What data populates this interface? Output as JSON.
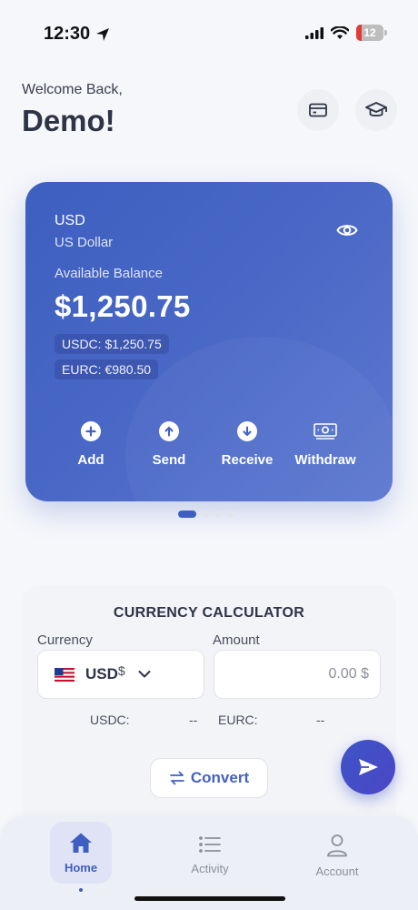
{
  "status_bar": {
    "time": "12:30",
    "battery": "12"
  },
  "header": {
    "greeting": "Welcome Back,",
    "username": "Demo!"
  },
  "icons": {
    "card": "credit-card-icon",
    "learn": "graduation-cap-icon"
  },
  "balance_card": {
    "currency_code": "USD",
    "currency_name": "US Dollar",
    "available_label": "Available Balance",
    "amount": "$1,250.75",
    "usdc": "USDC: $1,250.75",
    "eurc": "EURC: €980.50",
    "actions": [
      {
        "label": "Add",
        "icon": "plus-circle-icon"
      },
      {
        "label": "Send",
        "icon": "arrow-up-circle-icon"
      },
      {
        "label": "Receive",
        "icon": "arrow-down-circle-icon"
      },
      {
        "label": "Withdraw",
        "icon": "cash-icon"
      }
    ],
    "pager": {
      "pages": 4,
      "active": 1
    }
  },
  "calculator": {
    "title": "CURRENCY CALCULATOR",
    "currency_label": "Currency",
    "amount_label": "Amount",
    "selected_currency": "USD",
    "currency_symbol": "$",
    "amount_placeholder": "0.00 $",
    "usdc_label": "USDC:",
    "usdc_value": "--",
    "eurc_label": "EURC:",
    "eurc_value": "--",
    "convert_label": "Convert"
  },
  "tabs": [
    {
      "label": "Home",
      "active": true
    },
    {
      "label": "Activity",
      "active": false
    },
    {
      "label": "Account",
      "active": false
    }
  ],
  "colors": {
    "accent": "#3f5fc0",
    "card_gradient_start": "#3d5fc0",
    "card_gradient_end": "#5c78d0"
  }
}
